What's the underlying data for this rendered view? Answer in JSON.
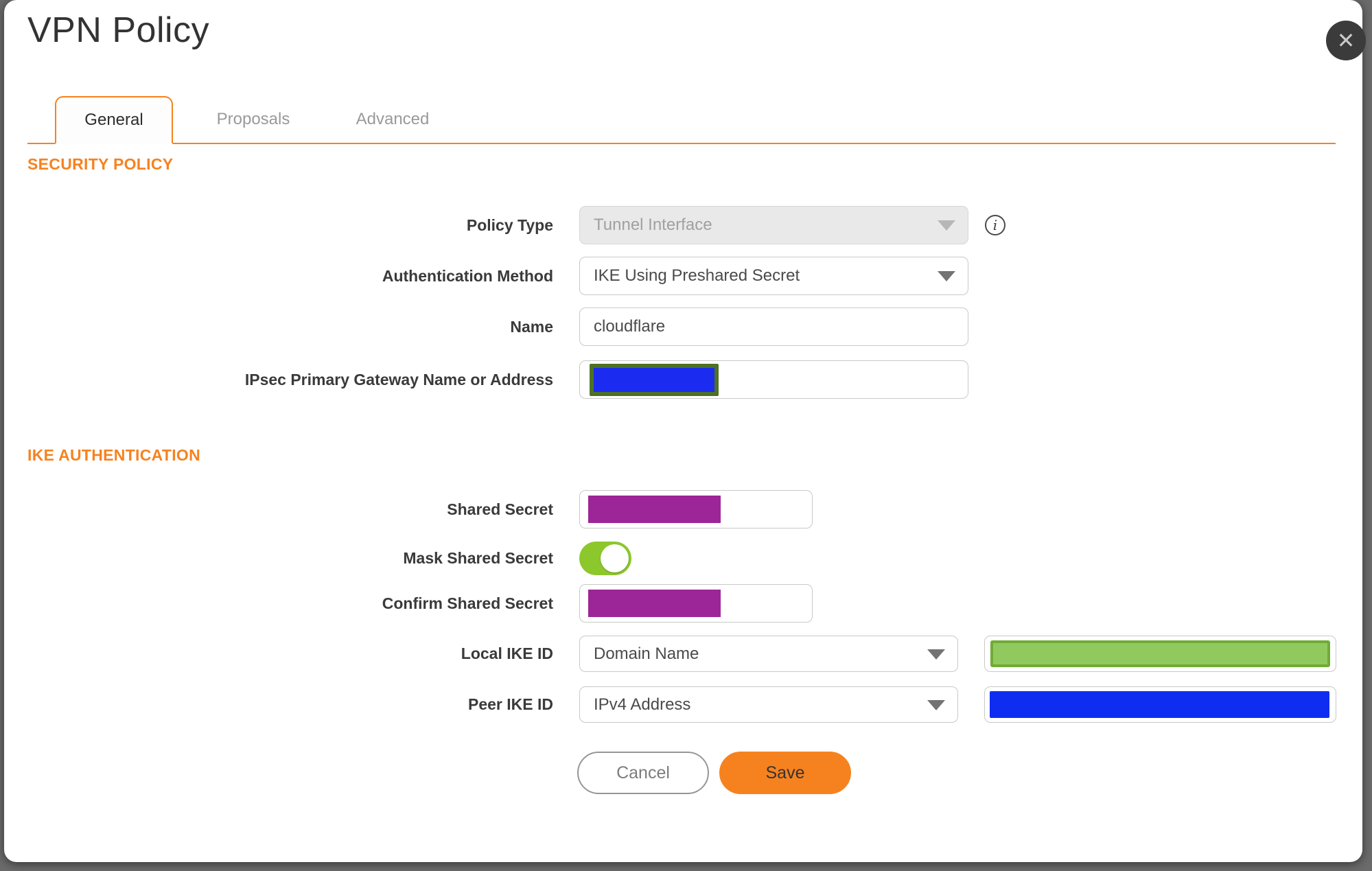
{
  "dialog": {
    "title": "VPN Policy",
    "close_icon": "x-close"
  },
  "tabs": [
    {
      "label": "General"
    },
    {
      "label": "Proposals"
    },
    {
      "label": "Advanced"
    }
  ],
  "active_tab": "General",
  "security_policy": {
    "heading": "SECURITY POLICY",
    "policy_type": {
      "label": "Policy Type",
      "value": "Tunnel Interface",
      "disabled": true,
      "info_icon": "info-circle"
    },
    "authentication_method": {
      "label": "Authentication Method",
      "value": "IKE Using Preshared Secret"
    },
    "name": {
      "label": "Name",
      "value": "cloudflare"
    },
    "gateway": {
      "label": "IPsec Primary Gateway Name or Address",
      "value_redacted": true
    }
  },
  "ike_authentication": {
    "heading": "IKE AUTHENTICATION",
    "shared_secret": {
      "label": "Shared Secret",
      "value_redacted": true
    },
    "mask_shared_secret": {
      "label": "Mask Shared Secret",
      "enabled": true
    },
    "confirm_shared_secret": {
      "label": "Confirm Shared Secret",
      "value_redacted": true
    },
    "local_ike_id": {
      "label": "Local IKE ID",
      "value": "Domain Name",
      "id_value_redacted": true
    },
    "peer_ike_id": {
      "label": "Peer IKE ID",
      "value": "IPv4 Address",
      "id_value_redacted": true
    }
  },
  "buttons": {
    "cancel": "Cancel",
    "save": "Save"
  },
  "colors": {
    "accent_orange": "#F6821F",
    "toggle_green": "#8CC82C",
    "redaction_purple": "#9C2597",
    "redaction_blue": "#0F2DF1",
    "redaction_gateway_blue": "#1B2CF0",
    "redaction_gateway_border_green": "#4E7125",
    "redaction_green_fill": "#90CA5E",
    "redaction_green_border": "#71AB36"
  }
}
